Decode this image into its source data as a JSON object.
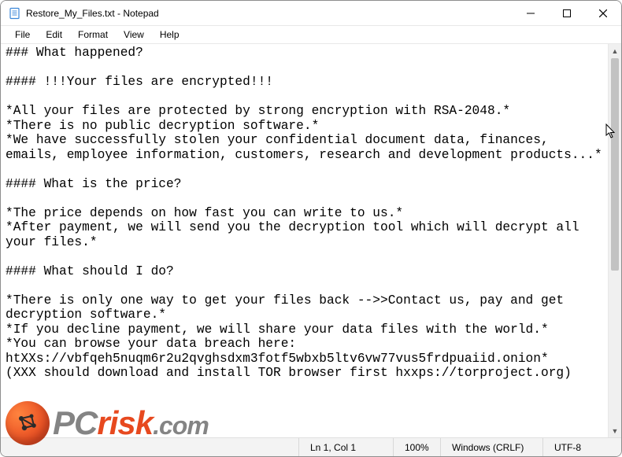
{
  "window": {
    "title": "Restore_My_Files.txt - Notepad"
  },
  "menu": {
    "file": "File",
    "edit": "Edit",
    "format": "Format",
    "view": "View",
    "help": "Help"
  },
  "content": {
    "text": "### What happened?\n\n#### !!!Your files are encrypted!!!\n\n*All your files are protected by strong encryption with RSA-2048.*\n*There is no public decryption software.*\n*We have successfully stolen your confidential document data, finances, emails, employee information, customers, research and development products...*\n\n#### What is the price?\n\n*The price depends on how fast you can write to us.*\n*After payment, we will send you the decryption tool which will decrypt all your files.*\n\n#### What should I do?\n\n*There is only one way to get your files back -->>Contact us, pay and get decryption software.*\n*If you decline payment, we will share your data files with the world.*\n*You can browse your data breach here:\nhtXXs://vbfqeh5nuqm6r2u2qvghsdxm3fotf5wbxb5ltv6vw77vus5frdpuaiid.onion*\n(XXX should download and install TOR browser first hxxps://torproject.org)"
  },
  "status": {
    "position": "Ln 1, Col 1",
    "zoom": "100%",
    "line_ending": "Windows (CRLF)",
    "encoding": "UTF-8"
  },
  "watermark": {
    "pc": "PC",
    "risk": "risk",
    "com": ".com"
  }
}
